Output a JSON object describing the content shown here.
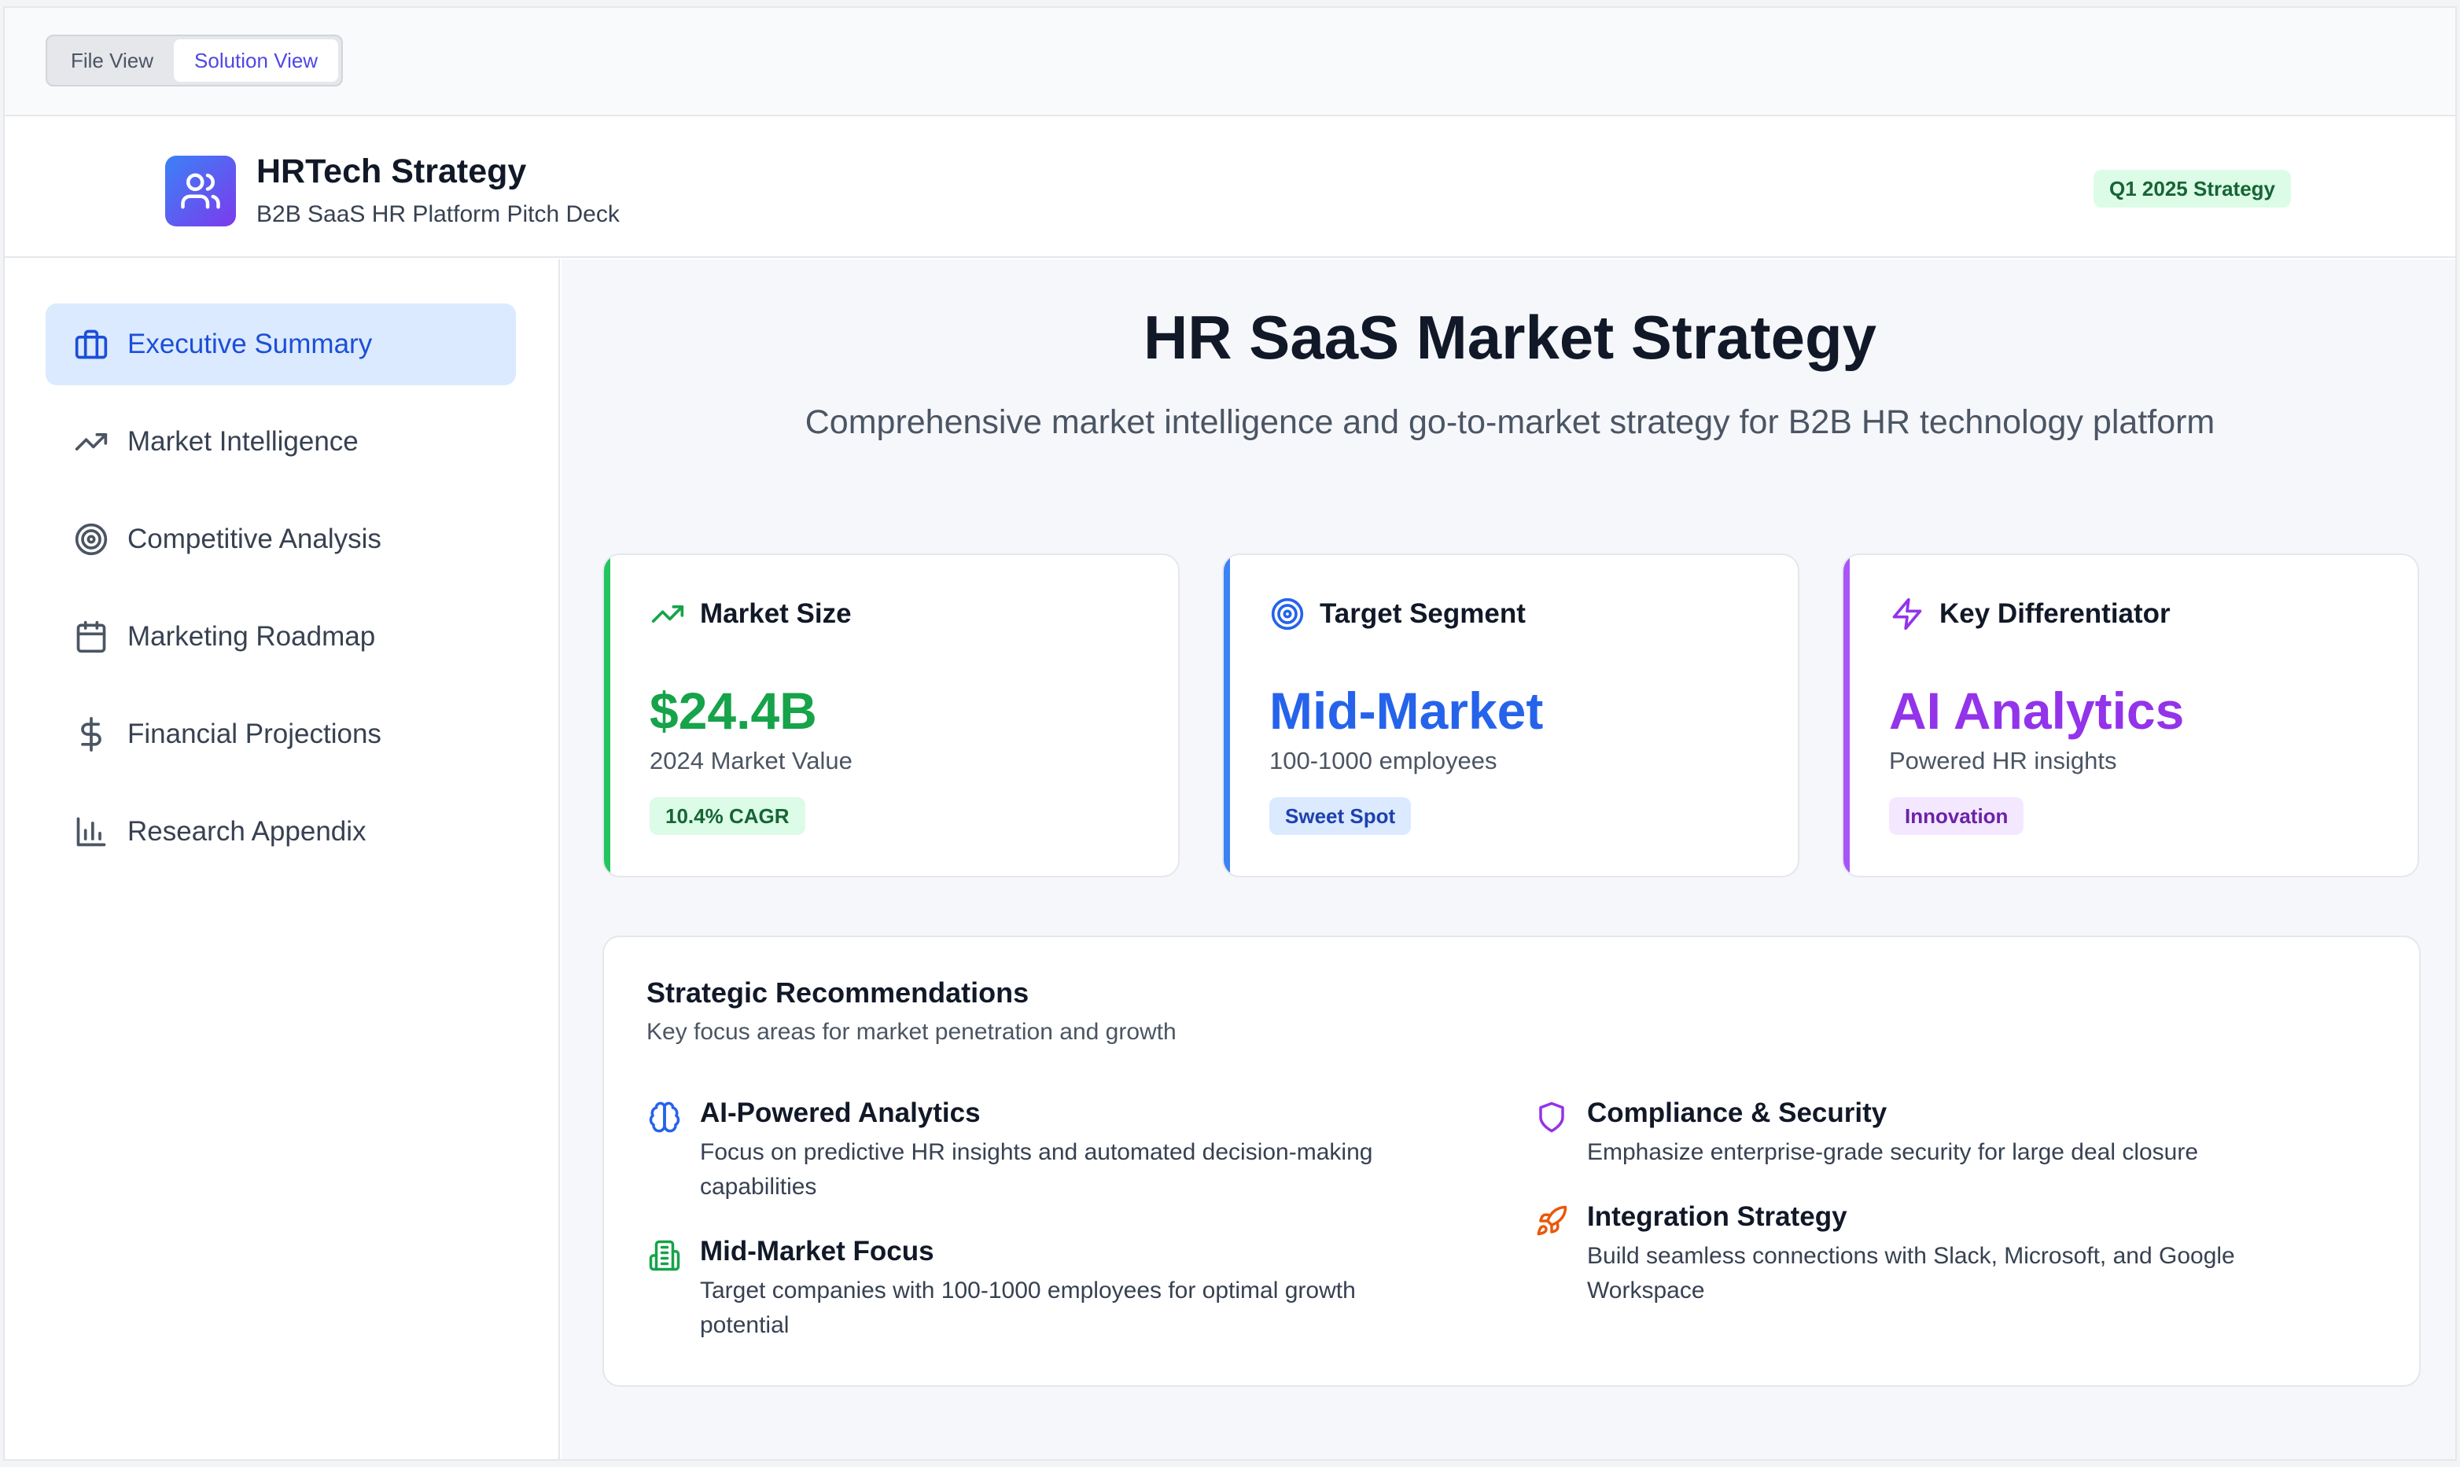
{
  "view_toggle": {
    "file_view": "File View",
    "solution_view": "Solution View"
  },
  "header": {
    "title": "HRTech Strategy",
    "subtitle": "B2B SaaS HR Platform Pitch Deck",
    "badge": "Q1 2025 Strategy",
    "logo_icon": "users-icon"
  },
  "sidebar": {
    "items": [
      {
        "label": "Executive Summary",
        "icon": "briefcase-icon",
        "active": true
      },
      {
        "label": "Market Intelligence",
        "icon": "trending-up-icon",
        "active": false
      },
      {
        "label": "Competitive Analysis",
        "icon": "target-icon",
        "active": false
      },
      {
        "label": "Marketing Roadmap",
        "icon": "calendar-icon",
        "active": false
      },
      {
        "label": "Financial Projections",
        "icon": "dollar-icon",
        "active": false
      },
      {
        "label": "Research Appendix",
        "icon": "bar-chart-icon",
        "active": false
      }
    ]
  },
  "main": {
    "title": "HR SaaS Market Strategy",
    "subtitle": "Comprehensive market intelligence and go-to-market strategy for B2B HR technology platform",
    "cards": [
      {
        "title": "Market Size",
        "value": "$24.4B",
        "desc": "2024 Market Value",
        "pill": "10.4% CAGR",
        "icon": "trending-up-icon",
        "accent": "#22c55e",
        "value_color": "#16a34a",
        "pill_bg": "#dcfce7",
        "pill_color": "#166534"
      },
      {
        "title": "Target Segment",
        "value": "Mid-Market",
        "desc": "100-1000 employees",
        "pill": "Sweet Spot",
        "icon": "target-icon",
        "accent": "#3b82f6",
        "value_color": "#2563eb",
        "pill_bg": "#dbeafe",
        "pill_color": "#1e40af"
      },
      {
        "title": "Key Differentiator",
        "value": "AI Analytics",
        "desc": "Powered HR insights",
        "pill": "Innovation",
        "icon": "zap-icon",
        "accent": "#a855f7",
        "value_color": "#9333ea",
        "pill_bg": "#f3e8ff",
        "pill_color": "#6b21a8"
      }
    ],
    "recommendations": {
      "title": "Strategic Recommendations",
      "subtitle": "Key focus areas for market penetration and growth",
      "items": [
        {
          "title": "AI-Powered Analytics",
          "desc": "Focus on predictive HR insights and automated decision-making capabilities",
          "icon": "brain-icon"
        },
        {
          "title": "Mid-Market Focus",
          "desc": "Target companies with 100-1000 employees for optimal growth potential",
          "icon": "building-icon"
        },
        {
          "title": "Compliance & Security",
          "desc": "Emphasize enterprise-grade security for large deal closure",
          "icon": "shield-icon"
        },
        {
          "title": "Integration Strategy",
          "desc": "Build seamless connections with Slack, Microsoft, and Google Workspace",
          "icon": "rocket-icon"
        }
      ]
    }
  }
}
